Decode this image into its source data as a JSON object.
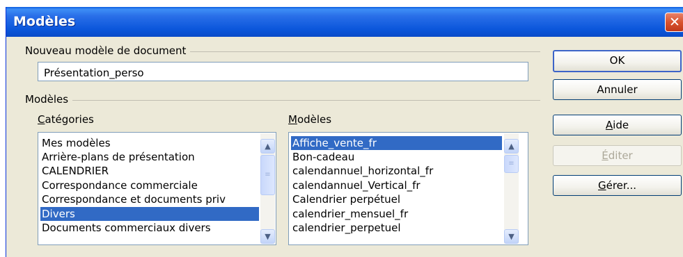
{
  "dialog": {
    "title": "Modèles",
    "close_glyph": "✕"
  },
  "new_doc": {
    "group_label": "Nouveau modèle de document",
    "name_value": "Présentation_perso"
  },
  "templates": {
    "group_label": "Modèles",
    "categories_label": "Catégories",
    "categories_accel": "C",
    "categories_rest": "atégories",
    "categories": [
      "Mes modèles",
      "Arrière-plans de présentation",
      "CALENDRIER",
      "Correspondance commerciale",
      "Correspondance et documents priv",
      "Divers",
      "Documents commerciaux divers"
    ],
    "categories_selected": "Divers",
    "models_label": "Modèles",
    "models_accel": "M",
    "models_rest": "odèles",
    "models": [
      "Affiche_vente_fr",
      "Bon-cadeau",
      "calendannuel_horizontal_fr",
      "calendannuel_Vertical_fr",
      "Calendrier perpétuel",
      "calendrier_mensuel_fr",
      "calendrier_perpetuel"
    ],
    "models_selected": "Affiche_vente_fr"
  },
  "buttons": {
    "ok": "OK",
    "cancel": "Annuler",
    "help_accel": "A",
    "help_rest": "ide",
    "edit_accel": "É",
    "edit_rest": "diter",
    "manage_accel": "G",
    "manage_rest": "érer..."
  },
  "colors": {
    "titlebar": "#0b56db",
    "selection": "#316ac5",
    "dialog_bg": "#ece9d8"
  },
  "icons": {
    "scroll_up": "▲",
    "scroll_down": "▼",
    "thumb_grip": "≡"
  }
}
